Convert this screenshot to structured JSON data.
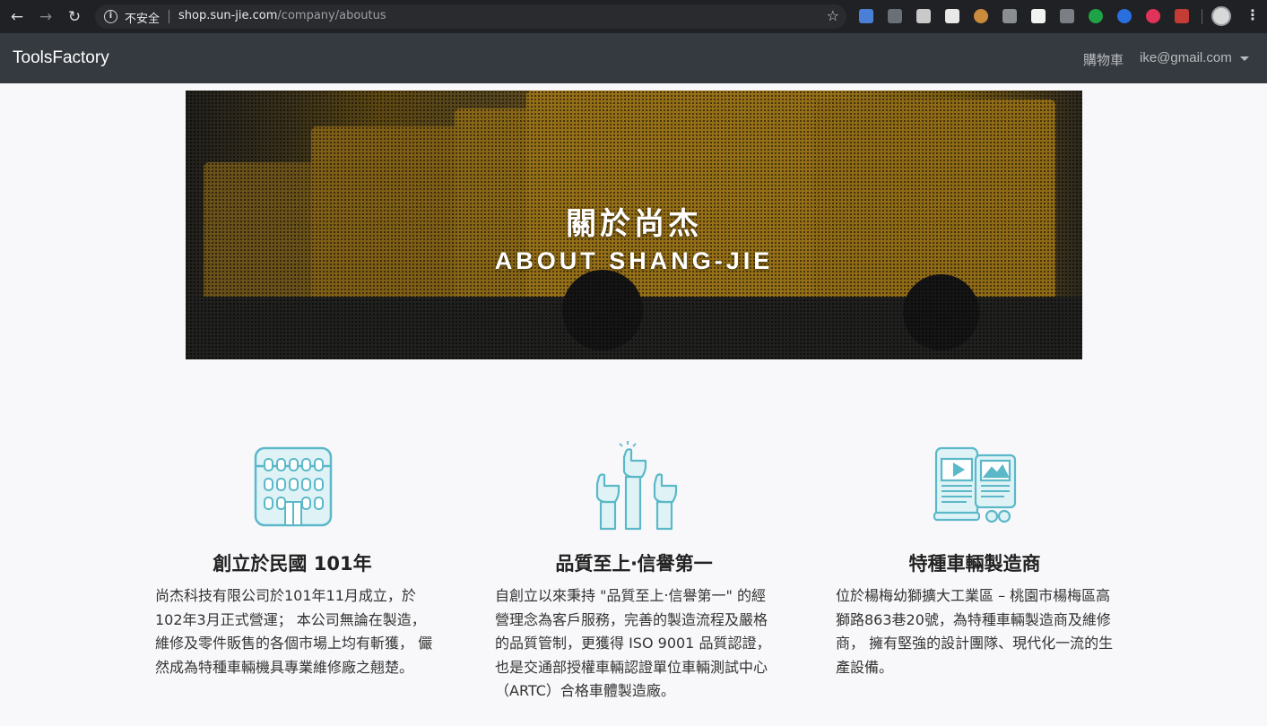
{
  "browser": {
    "insecure_label": "不安全",
    "url_host": "shop.sun-jie.com",
    "url_path": "/company/aboutus"
  },
  "navbar": {
    "brand": "ToolsFactory",
    "cart_label": "購物車",
    "user_label": "ike@gmail.com"
  },
  "hero": {
    "title": "關於尚杰",
    "subtitle": "ABOUT SHANG-JIE"
  },
  "features": [
    {
      "icon": "building-icon",
      "title": "創立於民國 101年",
      "text": "尚杰科技有限公司於101年11月成立，於102年3月正式營運； 本公司無論在製造，維修及零件販售的各個市場上均有斬獲， 儼然成為特種車輛機具專業維修廠之翹楚。"
    },
    {
      "icon": "pointing-hands-icon",
      "title": "品質至上‧信譽第一",
      "text": "自創立以來秉持 \"品質至上‧信譽第一\" 的經營理念為客戶服務，完善的製造流程及嚴格的品質管制，更獲得 ISO 9001 品質認證， 也是交通部授權車輛認證單位車輛測試中心（ARTC）合格車體製造廠。"
    },
    {
      "icon": "devices-icon",
      "title": "特種車輛製造商",
      "text": "位於楊梅幼獅擴大工業區 – 桃園市楊梅區高獅路863巷20號，為特種車輛製造商及維修商， 擁有堅強的設計團隊、現代化一流的生產設備。"
    }
  ],
  "colors": {
    "navbar_bg": "#343a40",
    "icon_stroke": "#5bb8c9",
    "icon_fill": "#dff3f6"
  }
}
